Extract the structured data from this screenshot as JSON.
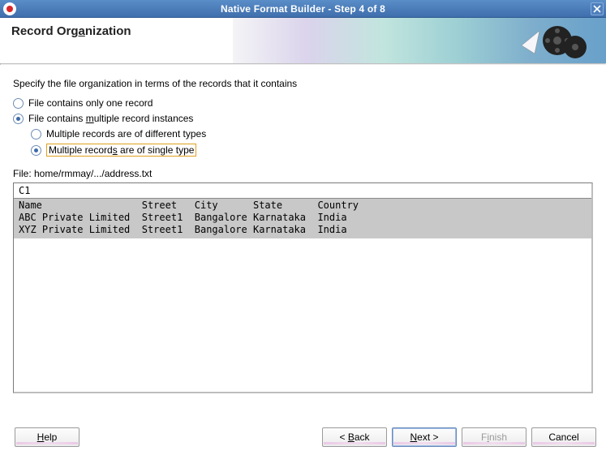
{
  "window": {
    "title": "Native Format Builder - Step 4 of 8"
  },
  "header": {
    "heading_prefix": "Record Org",
    "heading_key": "a",
    "heading_suffix": "nization"
  },
  "instruction": "Specify the file organization in terms of the records that it contains",
  "options": {
    "one_record": "File contains only one record",
    "multiple_prefix": "File contains ",
    "multiple_key": "m",
    "multiple_suffix": "ultiple record instances",
    "diff_types": "Multiple records are of different types",
    "single_prefix": "Multiple record",
    "single_key": "s",
    "single_suffix": " are of single type",
    "selected_top": "multiple",
    "selected_nested": "single"
  },
  "file_label": "File: home/rmmay/.../address.txt",
  "preview": {
    "column_header": "C1",
    "lines": [
      "Name                 Street   City      State      Country",
      "ABC Private Limited  Street1  Bangalore Karnataka  India",
      "XYZ Private Limited  Street1  Bangalore Karnataka  India"
    ]
  },
  "buttons": {
    "help_key": "H",
    "help_rest": "elp",
    "back_lt": "< ",
    "back_key": "B",
    "back_rest": "ack",
    "next_key": "N",
    "next_rest": "ext >",
    "finish_pre": "F",
    "finish_key": "i",
    "finish_post": "nish",
    "cancel": "Cancel"
  }
}
